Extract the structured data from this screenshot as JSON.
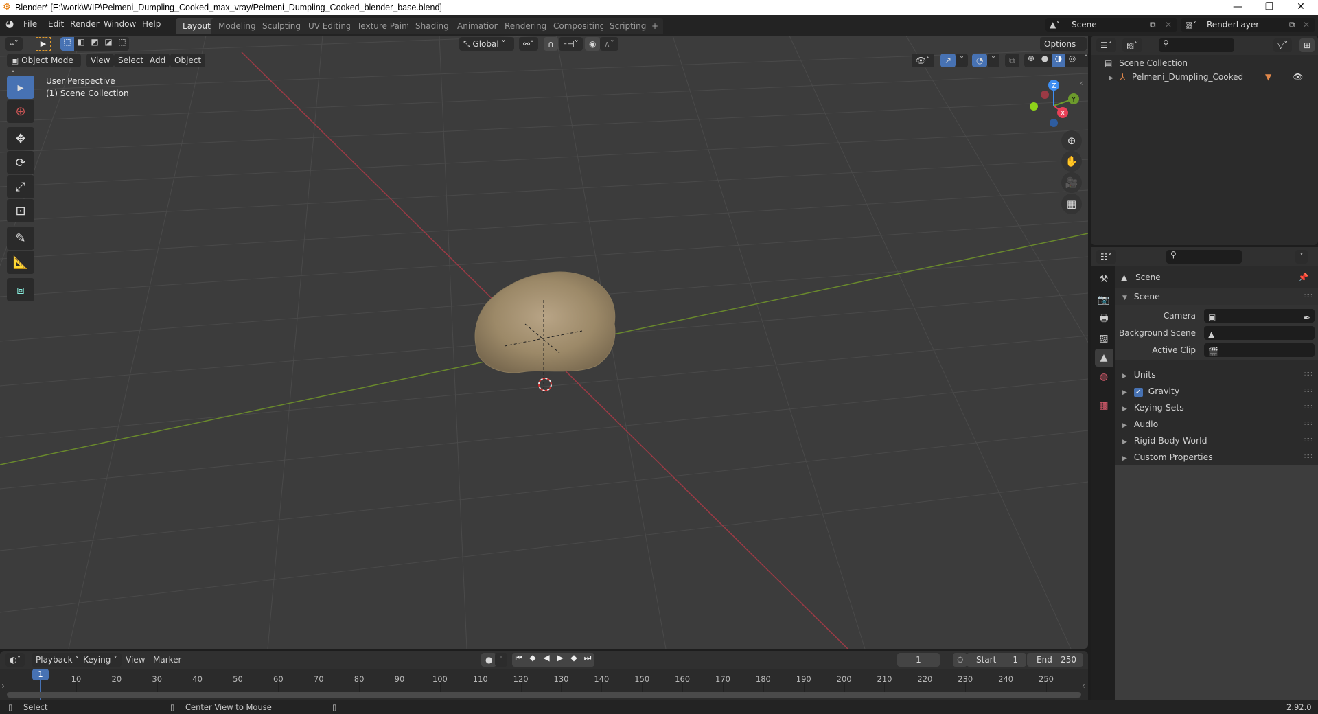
{
  "window": {
    "title": "Blender* [E:\\work\\WIP\\Pelmeni_Dumpling_Cooked_max_vray/Pelmeni_Dumpling_Cooked_blender_base.blend]",
    "minimize": "—",
    "restore": "❐",
    "close": "✕"
  },
  "menu": [
    "File",
    "Edit",
    "Render",
    "Window",
    "Help"
  ],
  "workspaces": [
    {
      "label": "Layout",
      "active": true
    },
    {
      "label": "Modeling"
    },
    {
      "label": "Sculpting"
    },
    {
      "label": "UV Editing"
    },
    {
      "label": "Texture Paint"
    },
    {
      "label": "Shading"
    },
    {
      "label": "Animation"
    },
    {
      "label": "Rendering"
    },
    {
      "label": "Compositing"
    },
    {
      "label": "Scripting"
    }
  ],
  "add_workspace": "+",
  "scene_selector": {
    "value": "Scene"
  },
  "view_layer_selector": {
    "value": "RenderLayer"
  },
  "viewport": {
    "transform_orientation": "Global",
    "options_label": "Options",
    "mode": "Object Mode",
    "header_menus": [
      "View",
      "Select",
      "Add",
      "Object"
    ],
    "overlay_text": [
      "User Perspective",
      "(1) Scene Collection"
    ],
    "gizmo_axes": [
      "Z",
      "Y",
      "X"
    ],
    "tools": [
      "select-box",
      "cursor",
      "move",
      "rotate",
      "scale",
      "transform",
      "annotate",
      "measure",
      "add-cube"
    ],
    "nav_buttons": [
      "zoom",
      "pan",
      "camera",
      "ortho-grid"
    ]
  },
  "outliner": {
    "root": "Scene Collection",
    "items": [
      {
        "label": "Pelmeni_Dumpling_Cooked",
        "visible": true
      }
    ]
  },
  "properties": {
    "context": "Scene",
    "section": "Scene",
    "fields": [
      {
        "label": "Camera",
        "value": ""
      },
      {
        "label": "Background Scene",
        "value": ""
      },
      {
        "label": "Active Clip",
        "value": ""
      }
    ],
    "panels": [
      {
        "label": "Units"
      },
      {
        "label": "Gravity",
        "checkbox": true
      },
      {
        "label": "Keying Sets"
      },
      {
        "label": "Audio"
      },
      {
        "label": "Rigid Body World"
      },
      {
        "label": "Custom Properties"
      }
    ]
  },
  "timeline": {
    "menus": [
      "Playback",
      "Keying",
      "View",
      "Marker"
    ],
    "current_frame": "1",
    "start_label": "Start",
    "start": "1",
    "end_label": "End",
    "end": "250",
    "playhead": "1",
    "ticks": [
      "10",
      "20",
      "30",
      "40",
      "50",
      "60",
      "70",
      "80",
      "90",
      "100",
      "110",
      "120",
      "130",
      "140",
      "150",
      "160",
      "170",
      "180",
      "190",
      "200",
      "210",
      "220",
      "230",
      "240",
      "250"
    ]
  },
  "status": {
    "left": "Select",
    "middle": "Center View to Mouse",
    "version": "2.92.0"
  }
}
